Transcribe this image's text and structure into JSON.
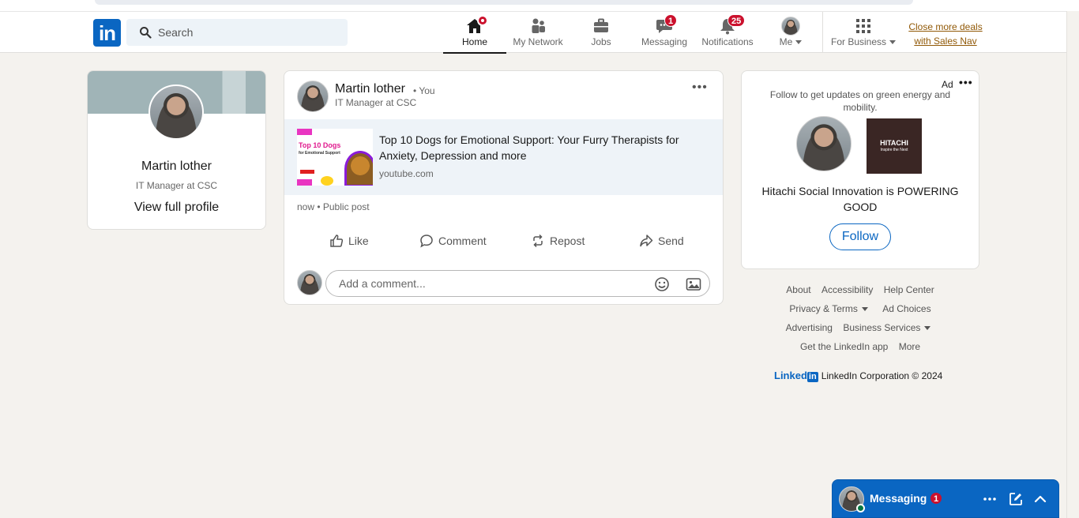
{
  "nav": {
    "search_placeholder": "Search",
    "items": [
      {
        "label": "Home",
        "icon": "home-icon"
      },
      {
        "label": "My Network",
        "icon": "network-icon"
      },
      {
        "label": "Jobs",
        "icon": "briefcase-icon"
      },
      {
        "label": "Messaging",
        "icon": "chat-icon",
        "badge": "1"
      },
      {
        "label": "Notifications",
        "icon": "bell-icon",
        "badge": "25"
      },
      {
        "label": "Me",
        "icon": "avatar"
      },
      {
        "label": "For Business",
        "icon": "grid-icon"
      }
    ],
    "sales_nav": "Close more deals with Sales Nav"
  },
  "profile_card": {
    "name": "Martin lother",
    "title": "IT Manager at CSC",
    "view_profile": "View full profile"
  },
  "post": {
    "author": "Martin lother",
    "you_label": "• You",
    "author_title": "IT Manager at CSC",
    "link_title": "Top 10 Dogs for Emotional Support: Your Furry Therapists for Anxiety, Depression and more",
    "link_source": "youtube.com",
    "thumb_title": "Top 10 Dogs",
    "thumb_subtitle": "for Emotional Support",
    "meta": "now • Public post",
    "actions": {
      "like": "Like",
      "comment": "Comment",
      "repost": "Repost",
      "send": "Send"
    },
    "comment_placeholder": "Add a comment..."
  },
  "ad": {
    "label": "Ad",
    "text": "Follow to get updates on green energy and mobility.",
    "brand_title": "HITACHI",
    "brand_tagline": "Inspire the Next",
    "headline": "Hitachi Social Innovation is POWERING GOOD",
    "follow": "Follow"
  },
  "footer": {
    "links_row1": [
      "About",
      "Accessibility",
      "Help Center"
    ],
    "links_row2": [
      "Privacy & Terms",
      "Ad Choices"
    ],
    "links_row3": [
      "Advertising",
      "Business Services"
    ],
    "links_row4": [
      "Get the LinkedIn app",
      "More"
    ],
    "brand": "Linked",
    "brand_in": "in",
    "copyright": "LinkedIn Corporation © 2024"
  },
  "messaging": {
    "label": "Messaging",
    "badge": "1"
  },
  "colors": {
    "brand": "#0a66c2",
    "badge": "#cb112d",
    "background": "#f4f2ee"
  }
}
